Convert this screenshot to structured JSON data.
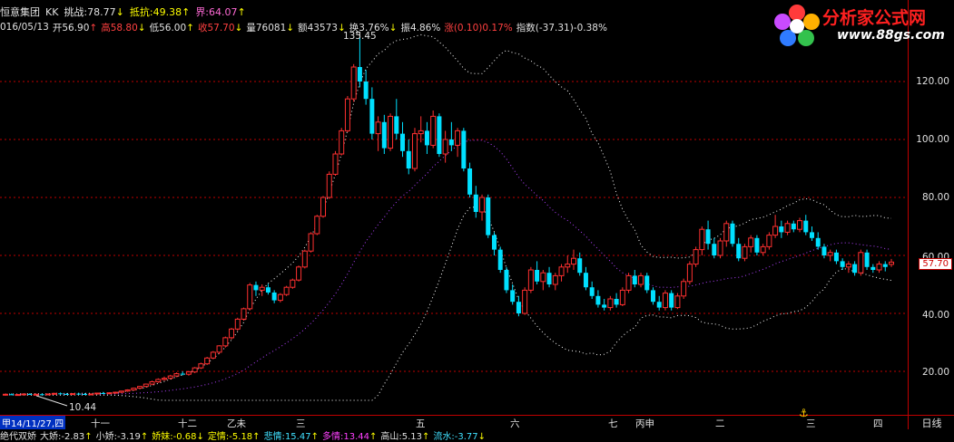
{
  "header": {
    "stock_name": "恒意集团",
    "indicator_name": "KK",
    "challenge_label": "挑战:",
    "challenge_value": "78.77",
    "resist_label": "抵抗:",
    "resist_value": "49.38",
    "boundary_label": "界:",
    "boundary_value": "64.07"
  },
  "quote": {
    "date": "016/05/13",
    "open_label": "开",
    "open": "56.90",
    "high_label": "高",
    "high": "58.80",
    "low_label": "低",
    "low": "56.00",
    "close_label": "收",
    "close": "57.70",
    "volume_label": "量",
    "volume": "76081",
    "amount_label": "额",
    "amount": "43573",
    "turnover_label": "换",
    "turnover": "3.76%",
    "amplitude_label": "振",
    "amplitude": "4.86%",
    "change_label": "涨",
    "change": "(0.10)",
    "change_pct": "0.17%",
    "index_label": "指数",
    "index_change": "(-37.31)",
    "index_pct": "-0.38%"
  },
  "logo": {
    "text": "分析家公式网",
    "url": "www.88gs.com"
  },
  "annotations": {
    "peak": "135.45",
    "trough": "10.44"
  },
  "yaxis": {
    "ticks": [
      "120.00",
      "100.00",
      "80.00",
      "60.00",
      "40.00",
      "20.00"
    ],
    "current_price": "57.70"
  },
  "xaxis": {
    "date_box": "甲14/11/27,四",
    "labels": [
      "十一",
      "十二",
      "乙未",
      "三",
      "五",
      "六",
      "七",
      "丙申",
      "二",
      "三",
      "四"
    ],
    "day_line": "日线"
  },
  "bottom_bar": {
    "name": "绝代双娇",
    "items": [
      {
        "label": "大娇:",
        "value": "-2.83"
      },
      {
        "label": "小娇:",
        "value": "-3.19"
      },
      {
        "label": "娇妹:",
        "value": "-0.68"
      },
      {
        "label": "定情:",
        "value": "-5.18"
      },
      {
        "label": "悲情:",
        "value": "15.47"
      },
      {
        "label": "多情:",
        "value": "13.44"
      },
      {
        "label": "高山:",
        "value": "5.13"
      },
      {
        "label": "流水:",
        "value": "-3.77"
      }
    ]
  },
  "colors": {
    "up": "#ff3030",
    "down": "#00e0ff",
    "grid": "#c00000",
    "upper_band": "#ffffff",
    "lower_band": "#ffffff",
    "mid_band": "#b040ff"
  },
  "chart_data": {
    "type": "candlestick",
    "ylim": [
      10,
      135.45
    ],
    "candles": [
      [
        12,
        12.3,
        11.6,
        12.1
      ],
      [
        12.1,
        12.4,
        11.8,
        11.9
      ],
      [
        11.9,
        12.2,
        11.6,
        12.0
      ],
      [
        12.0,
        12.3,
        11.8,
        12.2
      ],
      [
        12.2,
        12.5,
        11.9,
        11.9
      ],
      [
        11.9,
        12.3,
        11.7,
        12.1
      ],
      [
        12.1,
        12.4,
        11.8,
        12.0
      ],
      [
        12.0,
        12.3,
        11.9,
        12.2
      ],
      [
        12.2,
        12.6,
        12.0,
        12.4
      ],
      [
        12.4,
        12.7,
        12.1,
        12.2
      ],
      [
        12.2,
        12.5,
        11.9,
        12.1
      ],
      [
        12.1,
        12.5,
        11.9,
        12.3
      ],
      [
        12.3,
        12.6,
        12.0,
        12.2
      ],
      [
        12.2,
        12.5,
        11.9,
        12.0
      ],
      [
        12.0,
        12.4,
        11.8,
        12.2
      ],
      [
        12.2,
        12.6,
        12.0,
        12.5
      ],
      [
        12.5,
        12.9,
        12.2,
        12.4
      ],
      [
        12.4,
        12.8,
        12.1,
        12.6
      ],
      [
        12.6,
        13.0,
        12.3,
        12.8
      ],
      [
        12.8,
        13.3,
        12.5,
        13.2
      ],
      [
        13.2,
        13.8,
        12.9,
        13.6
      ],
      [
        13.6,
        14.4,
        13.3,
        14.2
      ],
      [
        14.2,
        15.0,
        13.9,
        14.8
      ],
      [
        14.8,
        15.8,
        14.5,
        15.6
      ],
      [
        15.6,
        16.8,
        15.2,
        16.4
      ],
      [
        16.4,
        17.6,
        16.0,
        17.2
      ],
      [
        17.2,
        18.2,
        16.8,
        17.6
      ],
      [
        17.6,
        18.8,
        17.2,
        18.4
      ],
      [
        18.4,
        19.6,
        18.0,
        19.2
      ],
      [
        19.2,
        20.0,
        18.6,
        19.0
      ],
      [
        19.0,
        20.2,
        18.5,
        19.8
      ],
      [
        19.8,
        21.5,
        19.4,
        21.2
      ],
      [
        21.2,
        23.0,
        20.8,
        22.6
      ],
      [
        22.6,
        25.0,
        22.2,
        24.6
      ],
      [
        24.6,
        27.0,
        24.2,
        26.6
      ],
      [
        26.6,
        29.0,
        26.0,
        28.8
      ],
      [
        28.8,
        32.0,
        28.2,
        31.6
      ],
      [
        31.6,
        35.0,
        31.0,
        34.6
      ],
      [
        34.6,
        38.5,
        34.0,
        38.0
      ],
      [
        38.0,
        42.0,
        37.5,
        41.6
      ],
      [
        41.6,
        50.5,
        41.0,
        49.8
      ],
      [
        49.8,
        51.0,
        46.0,
        48.0
      ],
      [
        48.0,
        50.0,
        46.0,
        49.0
      ],
      [
        49.0,
        50.2,
        46.5,
        47.2
      ],
      [
        47.2,
        48.0,
        43.5,
        44.5
      ],
      [
        44.5,
        47.0,
        43.8,
        46.5
      ],
      [
        46.5,
        49.5,
        46.0,
        49.0
      ],
      [
        49.0,
        52.0,
        48.5,
        51.5
      ],
      [
        51.5,
        56.5,
        51.0,
        56.0
      ],
      [
        56.0,
        62.0,
        55.5,
        61.5
      ],
      [
        61.5,
        68.0,
        61.0,
        67.5
      ],
      [
        67.5,
        74.0,
        67.0,
        73.5
      ],
      [
        73.5,
        80.5,
        73.0,
        80.0
      ],
      [
        80.0,
        89.0,
        79.5,
        88.0
      ],
      [
        88.0,
        96.0,
        87.5,
        95.0
      ],
      [
        95.0,
        104.0,
        94.5,
        103.0
      ],
      [
        103.0,
        115.0,
        102.5,
        114.0
      ],
      [
        114.0,
        126.0,
        113.0,
        125.0
      ],
      [
        125.0,
        135.45,
        118.0,
        120.0
      ],
      [
        120.0,
        124.0,
        112.0,
        114.0
      ],
      [
        114.0,
        118.0,
        100.0,
        102.0
      ],
      [
        102.0,
        108.0,
        96.0,
        106.0
      ],
      [
        106.0,
        108.5,
        95.0,
        97.0
      ],
      [
        97.0,
        109.0,
        96.0,
        108.0
      ],
      [
        108.0,
        114.0,
        100.0,
        102.0
      ],
      [
        102.0,
        106.0,
        94.0,
        96.0
      ],
      [
        96.0,
        100.0,
        88.0,
        90.0
      ],
      [
        90.0,
        104.0,
        89.0,
        102.0
      ],
      [
        102.0,
        108.0,
        99.0,
        103.0
      ],
      [
        103.0,
        106.0,
        95.0,
        98.0
      ],
      [
        98.0,
        110.0,
        97.0,
        108.0
      ],
      [
        108.0,
        109.0,
        94.0,
        95.0
      ],
      [
        95.0,
        103.0,
        92.0,
        100.0
      ],
      [
        100.0,
        106.0,
        96.0,
        98.0
      ],
      [
        98.0,
        104.0,
        94.0,
        103.0
      ],
      [
        103.0,
        104.0,
        89.0,
        90.0
      ],
      [
        90.0,
        92.0,
        80.0,
        81.0
      ],
      [
        81.0,
        84.0,
        73.0,
        75.0
      ],
      [
        75.0,
        81.0,
        72.0,
        80.0
      ],
      [
        80.0,
        81.0,
        66.0,
        67.0
      ],
      [
        67.0,
        68.0,
        60.0,
        62.0
      ],
      [
        62.0,
        63.0,
        54.0,
        55.0
      ],
      [
        55.0,
        56.0,
        47.0,
        48.0
      ],
      [
        48.0,
        50.0,
        43.0,
        44.0
      ],
      [
        44.0,
        46.0,
        39.0,
        40.0
      ],
      [
        40.0,
        49.0,
        39.5,
        48.0
      ],
      [
        48.0,
        56.0,
        47.0,
        55.0
      ],
      [
        55.0,
        58.0,
        50.0,
        51.0
      ],
      [
        51.0,
        55.0,
        48.0,
        54.0
      ],
      [
        54.0,
        56.0,
        49.0,
        50.0
      ],
      [
        50.0,
        54.0,
        48.0,
        53.0
      ],
      [
        53.0,
        57.0,
        51.0,
        56.0
      ],
      [
        56.0,
        60.0,
        54.0,
        57.0
      ],
      [
        57.0,
        62.0,
        55.0,
        59.0
      ],
      [
        59.0,
        61.0,
        53.0,
        54.0
      ],
      [
        54.0,
        56.0,
        48.0,
        49.0
      ],
      [
        49.0,
        51.0,
        45.0,
        46.0
      ],
      [
        46.0,
        48.0,
        42.0,
        43.0
      ],
      [
        43.0,
        45.0,
        41.0,
        42.0
      ],
      [
        42.0,
        46.0,
        41.0,
        45.0
      ],
      [
        45.0,
        47.0,
        42.0,
        43.0
      ],
      [
        43.0,
        49.0,
        42.5,
        48.0
      ],
      [
        48.0,
        54.0,
        47.0,
        53.0
      ],
      [
        53.0,
        55.0,
        49.0,
        50.0
      ],
      [
        50.0,
        54.0,
        49.0,
        53.0
      ],
      [
        53.0,
        54.0,
        47.0,
        48.0
      ],
      [
        48.0,
        49.0,
        43.0,
        44.0
      ],
      [
        44.0,
        46.0,
        41.0,
        42.0
      ],
      [
        42.0,
        48.0,
        41.0,
        47.0
      ],
      [
        47.0,
        48.0,
        41.0,
        42.0
      ],
      [
        42.0,
        47.0,
        41.5,
        46.0
      ],
      [
        46.0,
        52.0,
        45.0,
        51.0
      ],
      [
        51.0,
        58.0,
        50.0,
        57.0
      ],
      [
        57.0,
        63.0,
        56.0,
        62.0
      ],
      [
        62.0,
        70.0,
        60.0,
        69.0
      ],
      [
        69.0,
        72.0,
        62.0,
        64.0
      ],
      [
        64.0,
        66.0,
        59.0,
        60.0
      ],
      [
        60.0,
        66.0,
        59.0,
        65.0
      ],
      [
        65.0,
        72.0,
        63.0,
        71.0
      ],
      [
        71.0,
        72.0,
        63.0,
        64.0
      ],
      [
        64.0,
        66.0,
        58.0,
        59.0
      ],
      [
        59.0,
        64.0,
        58.0,
        63.0
      ],
      [
        63.0,
        67.0,
        61.0,
        66.0
      ],
      [
        66.0,
        67.0,
        60.0,
        61.0
      ],
      [
        61.0,
        64.0,
        60.0,
        63.0
      ],
      [
        63.0,
        68.0,
        62.0,
        67.0
      ],
      [
        67.0,
        74.0,
        66.0,
        70.0
      ],
      [
        70.0,
        72.0,
        66.0,
        68.0
      ],
      [
        68.0,
        72.0,
        67.0,
        71.0
      ],
      [
        71.0,
        72.0,
        68.0,
        69.0
      ],
      [
        69.0,
        73.0,
        68.0,
        72.0
      ],
      [
        72.0,
        74.0,
        67.0,
        68.0
      ],
      [
        68.0,
        70.0,
        65.0,
        66.0
      ],
      [
        66.0,
        68.0,
        62.0,
        63.0
      ],
      [
        63.0,
        64.0,
        59.0,
        60.0
      ],
      [
        60.0,
        62.0,
        58.0,
        61.0
      ],
      [
        61.0,
        62.0,
        57.0,
        58.0
      ],
      [
        58.0,
        59.0,
        55.0,
        56.0
      ],
      [
        56.0,
        58.0,
        54.0,
        57.0
      ],
      [
        57.0,
        58.0,
        53.0,
        54.0
      ],
      [
        54.0,
        62.0,
        53.0,
        61.0
      ],
      [
        61.0,
        62.0,
        55.0,
        56.0
      ],
      [
        56.0,
        57.0,
        54.0,
        55.0
      ],
      [
        55.0,
        58.0,
        54.0,
        57.0
      ],
      [
        57.0,
        58.0,
        54.5,
        56.0
      ],
      [
        56.9,
        58.8,
        56.0,
        57.7
      ]
    ]
  }
}
